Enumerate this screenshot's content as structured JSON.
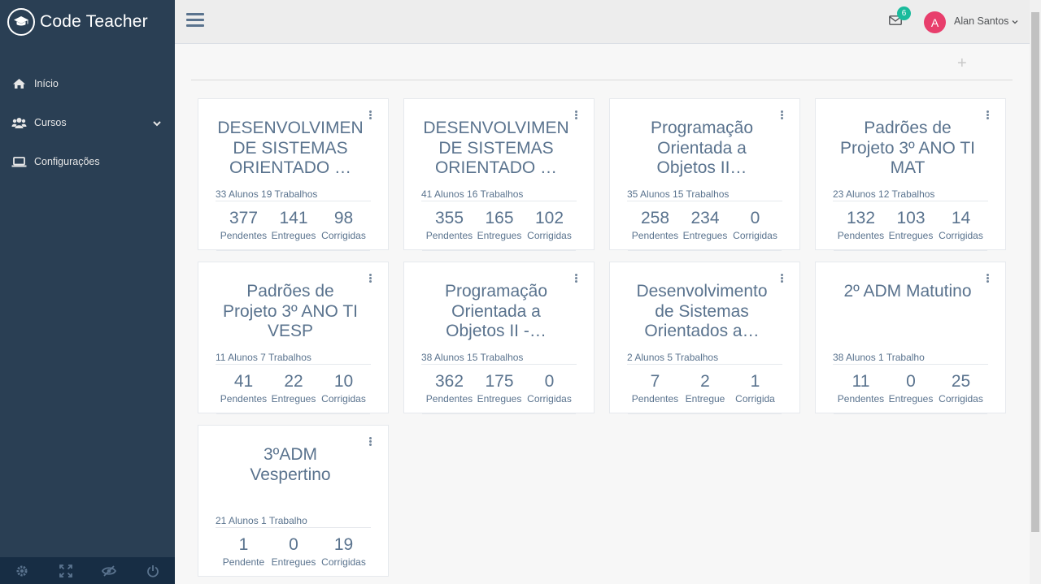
{
  "app": {
    "title": "Code Teacher"
  },
  "sidebar": {
    "items": [
      {
        "label": "Início",
        "icon": "home-icon"
      },
      {
        "label": "Cursos",
        "icon": "users-icon"
      },
      {
        "label": "Configurações",
        "icon": "laptop-icon"
      }
    ]
  },
  "header": {
    "notifications": "6",
    "avatar_letter": "A",
    "user_name": "Alan Santos"
  },
  "toolbar": {
    "add_label": "+"
  },
  "courses": [
    {
      "title": "DESENVOLVIMENTO DE SISTEMAS ORIENTADO ...",
      "title_display": "DESENVOLVIMEN\nDE SISTEMAS\nORIENTADO …",
      "meta": "33 Alunos 19 Trabalhos",
      "stats": [
        {
          "n": "377",
          "l": "Pendentes"
        },
        {
          "n": "141",
          "l": "Entregues"
        },
        {
          "n": "98",
          "l": "Corrigidas"
        }
      ]
    },
    {
      "title": "DESENVOLVIMENTO DE SISTEMAS ORIENTADO ...",
      "title_display": "DESENVOLVIMEN\nDE SISTEMAS\nORIENTADO …",
      "meta": "41 Alunos 16 Trabalhos",
      "stats": [
        {
          "n": "355",
          "l": "Pendentes"
        },
        {
          "n": "165",
          "l": "Entregues"
        },
        {
          "n": "102",
          "l": "Corrigidas"
        }
      ]
    },
    {
      "title": "Programação Orientada a Objetos II...",
      "title_display": "Programação\nOrientada a\nObjetos II…",
      "meta": "35 Alunos 15 Trabalhos",
      "stats": [
        {
          "n": "258",
          "l": "Pendentes"
        },
        {
          "n": "234",
          "l": "Entregues"
        },
        {
          "n": "0",
          "l": "Corrigidas"
        }
      ]
    },
    {
      "title": "Padrões de Projeto 3º ANO TI MAT",
      "title_display": "Padrões de\nProjeto 3º ANO TI\nMAT",
      "meta": "23 Alunos 12 Trabalhos",
      "stats": [
        {
          "n": "132",
          "l": "Pendentes"
        },
        {
          "n": "103",
          "l": "Entregues"
        },
        {
          "n": "14",
          "l": "Corrigidas"
        }
      ]
    },
    {
      "title": "Padrões de Projeto 3º ANO TI VESP",
      "title_display": "Padrões de\nProjeto 3º ANO TI\nVESP",
      "meta": "11 Alunos 7 Trabalhos",
      "stats": [
        {
          "n": "41",
          "l": "Pendentes"
        },
        {
          "n": "22",
          "l": "Entregues"
        },
        {
          "n": "10",
          "l": "Corrigidas"
        }
      ]
    },
    {
      "title": "Programação Orientada a Objetos II -...",
      "title_display": "Programação\nOrientada a\nObjetos II -…",
      "meta": "38 Alunos 15 Trabalhos",
      "stats": [
        {
          "n": "362",
          "l": "Pendentes"
        },
        {
          "n": "175",
          "l": "Entregues"
        },
        {
          "n": "0",
          "l": "Corrigidas"
        }
      ]
    },
    {
      "title": "Desenvolvimento de Sistemas Orientados a...",
      "title_display": "Desenvolvimento\nde Sistemas\nOrientados a…",
      "meta": "2 Alunos 5 Trabalhos",
      "stats": [
        {
          "n": "7",
          "l": "Pendentes"
        },
        {
          "n": "2",
          "l": "Entregue"
        },
        {
          "n": "1",
          "l": "Corrigida"
        }
      ]
    },
    {
      "title": "2º ADM Matutino",
      "title_display": "2º ADM Matutino",
      "meta": "38 Alunos 1 Trabalho",
      "stats": [
        {
          "n": "11",
          "l": "Pendentes"
        },
        {
          "n": "0",
          "l": "Entregues"
        },
        {
          "n": "25",
          "l": "Corrigidas"
        }
      ]
    },
    {
      "title": "3ºADM Vespertino",
      "title_display": "3ºADM\nVespertino",
      "meta": "21 Alunos 1 Trabalho",
      "stats": [
        {
          "n": "1",
          "l": "Pendente"
        },
        {
          "n": "0",
          "l": "Entregues"
        },
        {
          "n": "19",
          "l": "Corrigidas"
        }
      ]
    }
  ],
  "footer": {
    "icons": [
      "settings-icon",
      "fullscreen-icon",
      "lock-icon",
      "logout-icon"
    ]
  },
  "colors": {
    "sidebar": "#2a3f54",
    "accent": "#1abb9c",
    "avatar": "#e83e6c"
  }
}
